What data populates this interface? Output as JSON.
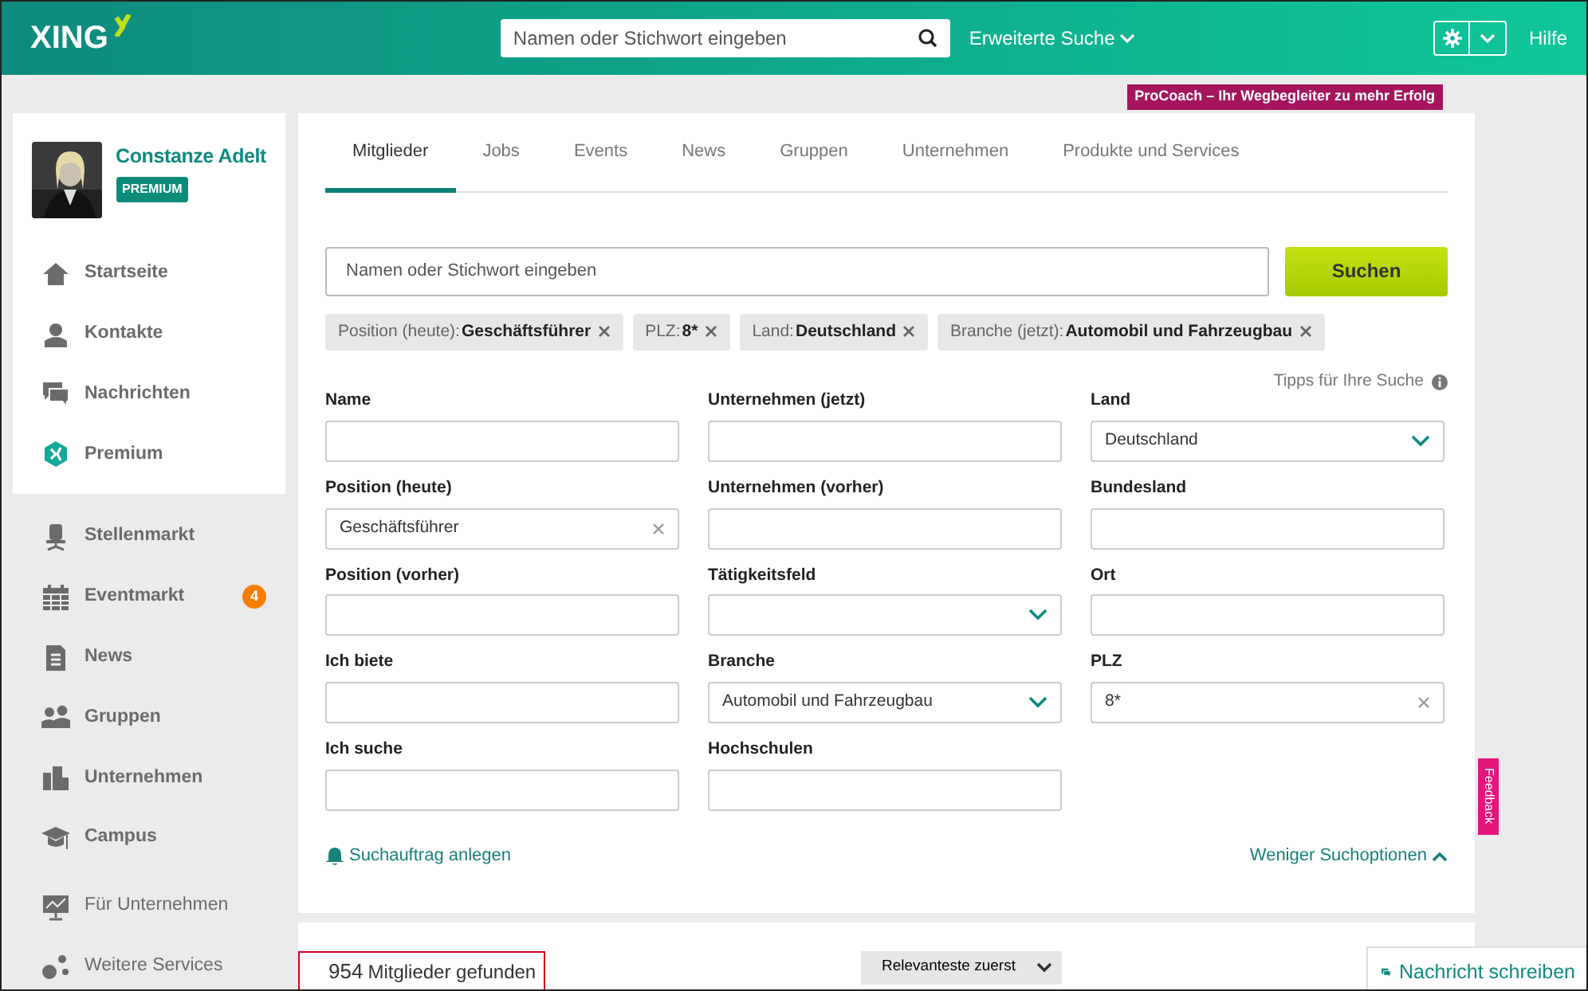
{
  "header": {
    "logo": "XING",
    "search_placeholder": "Namen oder Stichwort eingeben",
    "advanced_search": "Erweiterte Suche",
    "help": "Hilfe"
  },
  "promo": "ProCoach – Ihr Wegbegleiter zu mehr Erfolg",
  "profile": {
    "name": "Constanze Adelt",
    "badge": "PREMIUM"
  },
  "sidebar": {
    "sections": [
      {
        "items": [
          {
            "label": "Startseite"
          },
          {
            "label": "Kontakte"
          },
          {
            "label": "Nachrichten"
          },
          {
            "label": "Premium"
          }
        ]
      },
      {
        "items": [
          {
            "label": "Stellenmarkt"
          },
          {
            "label": "Eventmarkt",
            "badge": "4"
          },
          {
            "label": "News"
          },
          {
            "label": "Gruppen"
          },
          {
            "label": "Unternehmen"
          },
          {
            "label": "Campus"
          }
        ]
      },
      {
        "items": [
          {
            "label": "Für Unternehmen"
          },
          {
            "label": "Weitere Services"
          }
        ]
      }
    ]
  },
  "tabs": [
    {
      "label": "Mitglieder",
      "selected": true
    },
    {
      "label": "Jobs",
      "selected": false
    },
    {
      "label": "Events",
      "selected": false
    },
    {
      "label": "News",
      "selected": false
    },
    {
      "label": "Gruppen",
      "selected": false
    },
    {
      "label": "Unternehmen",
      "selected": false
    },
    {
      "label": "Produkte und Services",
      "selected": false
    }
  ],
  "search": {
    "placeholder": "Namen oder Stichwort eingeben",
    "button": "Suchen"
  },
  "filters": [
    {
      "label": "Position (heute):",
      "value": "Geschäftsführer"
    },
    {
      "label": "PLZ:",
      "value": "8*"
    },
    {
      "label": "Land:",
      "value": "Deutschland"
    },
    {
      "label": "Branche (jetzt):",
      "value": "Automobil und Fahrzeugbau"
    }
  ],
  "tips": "Tipps für Ihre Suche",
  "fields": [
    {
      "label": "Name",
      "kind": "text"
    },
    {
      "label": "Unternehmen (jetzt)",
      "kind": "text"
    },
    {
      "label": "Land",
      "kind": "select",
      "value": "Deutschland"
    },
    {
      "label": "Position (heute)",
      "kind": "clearable",
      "value": "Geschäftsführer"
    },
    {
      "label": "Unternehmen (vorher)",
      "kind": "text"
    },
    {
      "label": "Bundesland",
      "kind": "text"
    },
    {
      "label": "Position (vorher)",
      "kind": "text"
    },
    {
      "label": "Tätigkeitsfeld",
      "kind": "select"
    },
    {
      "label": "Ort",
      "kind": "text"
    },
    {
      "label": "Ich biete",
      "kind": "text"
    },
    {
      "label": "Branche",
      "kind": "select",
      "value": "Automobil und Fahrzeugbau"
    },
    {
      "label": "PLZ",
      "kind": "clearable",
      "value": "8*"
    },
    {
      "label": "Ich suche",
      "kind": "text"
    },
    {
      "label": "Hochschulen",
      "kind": "text"
    }
  ],
  "save_search": "Suchauftrag anlegen",
  "fewer_options": "Weniger Suchoptionen",
  "results": {
    "count": "954",
    "label": "Mitglieder gefunden",
    "sort": "Relevanteste zuerst"
  },
  "feedback": "Feedback",
  "message_button": "Nachricht schreiben"
}
